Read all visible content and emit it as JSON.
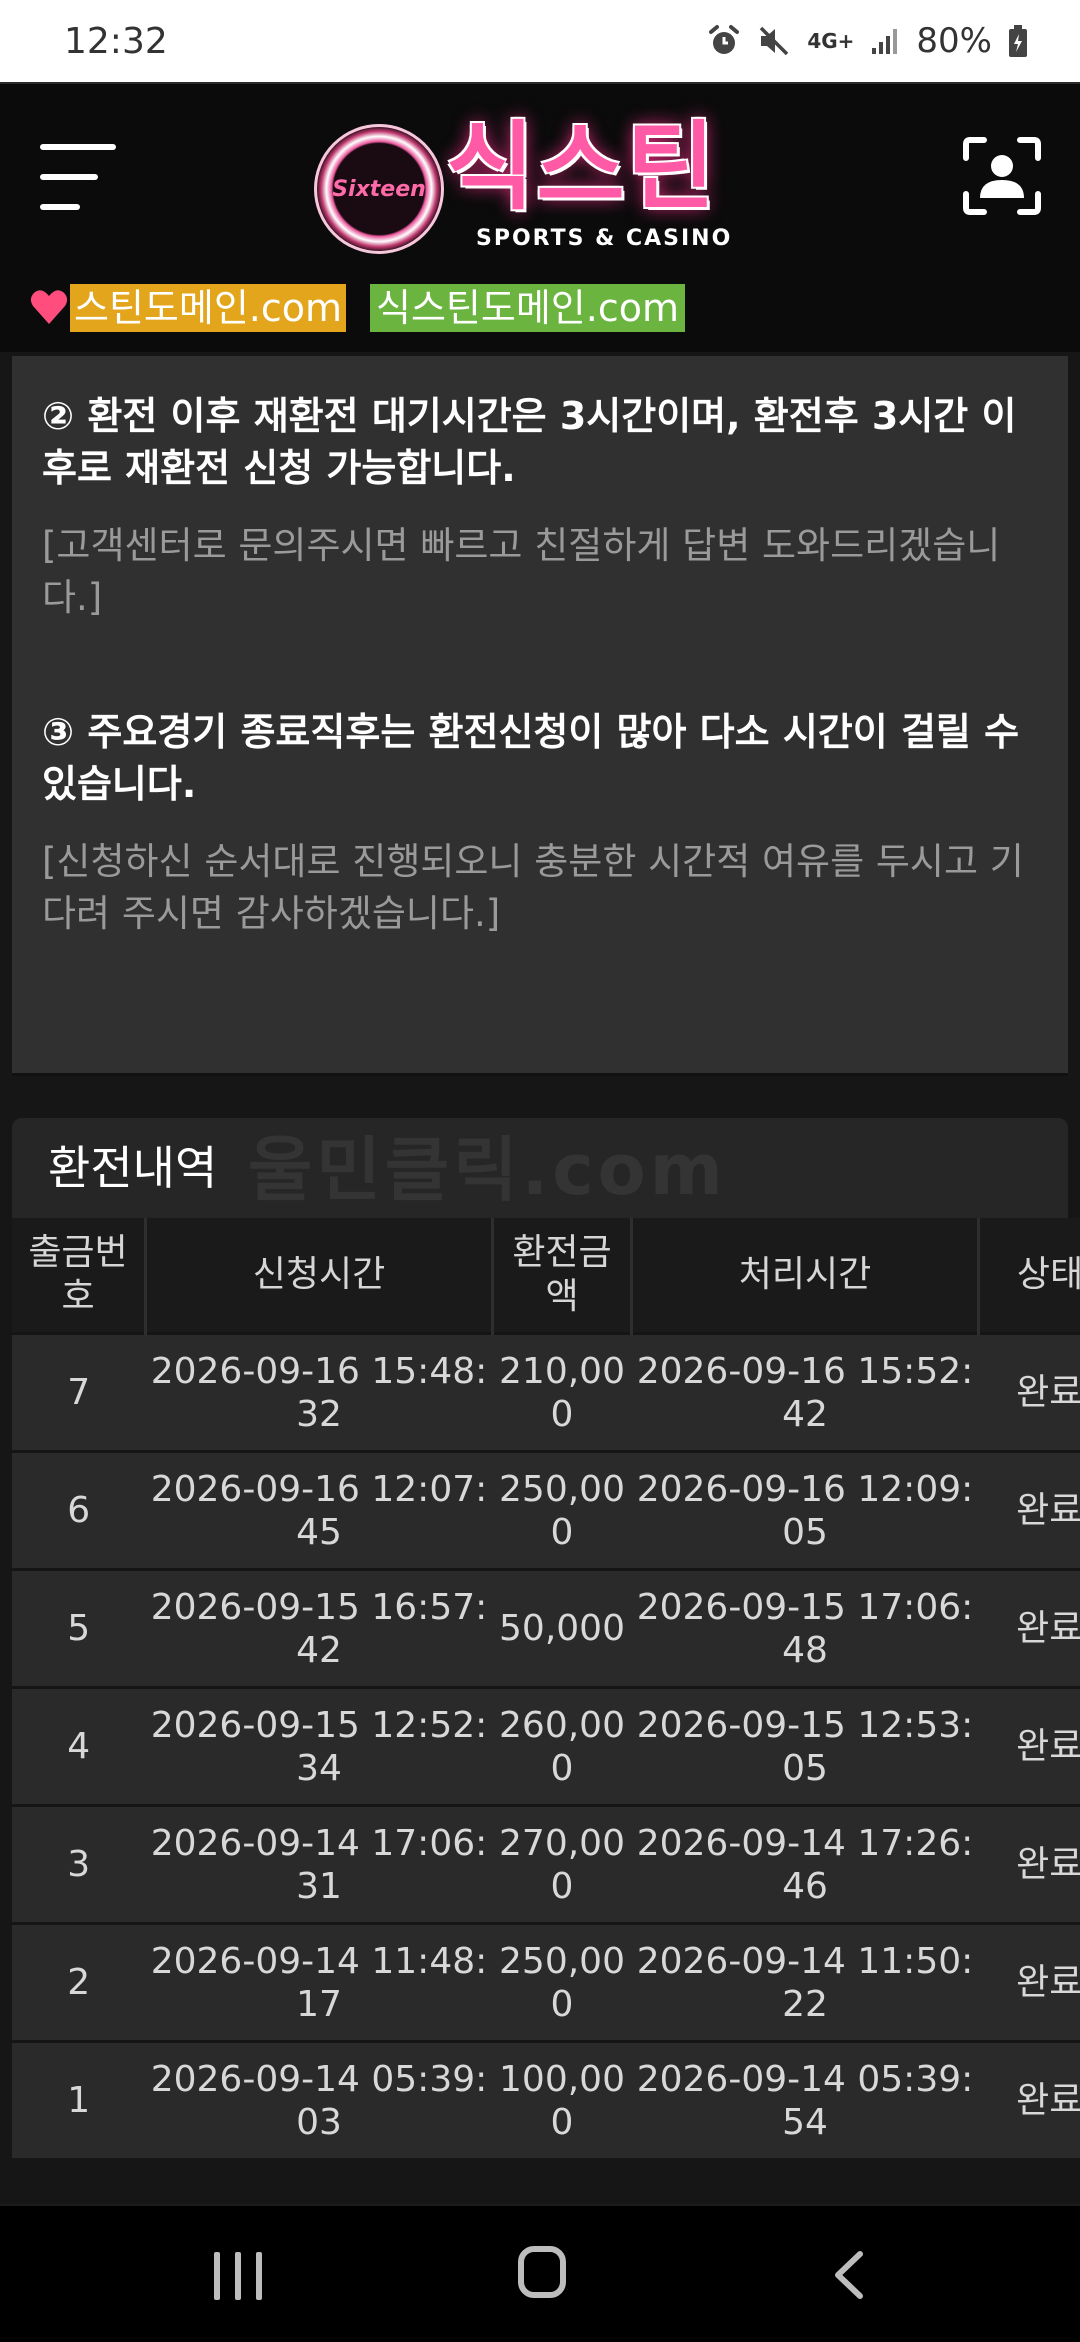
{
  "status_bar": {
    "time": "12:32",
    "network": "4G+",
    "battery": "80%",
    "icons": [
      "alarm-icon",
      "mute-icon",
      "signal-icon",
      "battery-icon"
    ]
  },
  "header": {
    "logo_badge": "Sixteen",
    "logo_title": "식스틴",
    "logo_subtitle": "SPORTS & CASINO",
    "accent_color": "#ff5aa5"
  },
  "domains": {
    "domain1": "스틴도메인.com",
    "domain2": "식스틴도메인.com",
    "domain1_color": "#e3a51c",
    "domain2_color": "#6ab43f"
  },
  "notice": {
    "item2_title": "② 환전 이후 재환전 대기시간은 3시간이며, 환전후 3시간 이후로 재환전 신청 가능합니다.",
    "item2_desc": "[고객센터로 문의주시면 빠르고 친절하게 답변 도와드리겠습니다.]",
    "item3_title": "③ 주요경기 종료직후는 환전신청이 많아 다소 시간이 걸릴 수 있습니다.",
    "item3_desc": "[신청하신 순서대로 진행되오니 충분한 시간적 여유를 두시고 기다려 주시면 감사하겠습니다.]"
  },
  "history": {
    "title": "환전내역",
    "watermark": "울민클릭.com",
    "columns": [
      "출금번호",
      "신청시간",
      "환전금액",
      "처리시간",
      "상태"
    ],
    "rows": [
      {
        "no": "7",
        "requested": "2026-09-16 15:48:32",
        "amount": "210,000",
        "processed": "2026-09-16 15:52:42",
        "status": "완료"
      },
      {
        "no": "6",
        "requested": "2026-09-16 12:07:45",
        "amount": "250,000",
        "processed": "2026-09-16 12:09:05",
        "status": "완료"
      },
      {
        "no": "5",
        "requested": "2026-09-15 16:57:42",
        "amount": "50,000",
        "processed": "2026-09-15 17:06:48",
        "status": "완료"
      },
      {
        "no": "4",
        "requested": "2026-09-15 12:52:34",
        "amount": "260,000",
        "processed": "2026-09-15 12:53:05",
        "status": "완료"
      },
      {
        "no": "3",
        "requested": "2026-09-14 17:06:31",
        "amount": "270,000",
        "processed": "2026-09-14 17:26:46",
        "status": "완료"
      },
      {
        "no": "2",
        "requested": "2026-09-14 11:48:17",
        "amount": "250,000",
        "processed": "2026-09-14 11:50:22",
        "status": "완료"
      },
      {
        "no": "1",
        "requested": "2026-09-14 05:39:03",
        "amount": "100,000",
        "processed": "2026-09-14 05:39:54",
        "status": "완료"
      }
    ]
  },
  "navbar": {
    "icons": [
      "recent-apps-icon",
      "home-icon",
      "back-icon"
    ]
  }
}
